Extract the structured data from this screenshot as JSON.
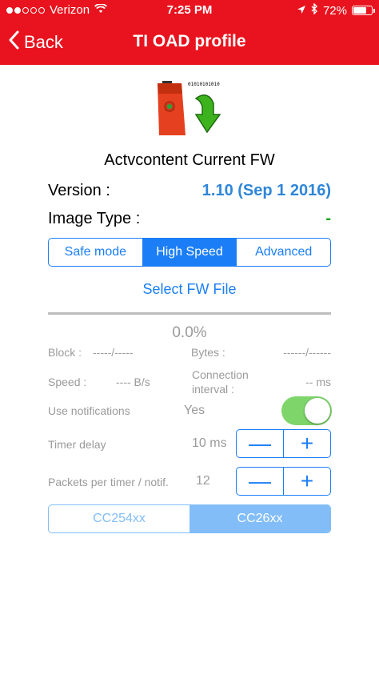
{
  "status": {
    "carrier": "Verizon",
    "time": "7:25 PM",
    "battery": "72%",
    "battery_level": 0.72
  },
  "nav": {
    "back_label": "Back",
    "title": "TI OAD profile"
  },
  "device_image": {
    "binary_text": "01010101010"
  },
  "firmware": {
    "title": "Actvcontent Current FW",
    "version_label": "Version :",
    "version_value": "1.10 (Sep  1 2016)",
    "image_type_label": "Image Type :",
    "image_type_value": "-"
  },
  "mode_tabs": {
    "options": [
      "Safe mode",
      "High Speed",
      "Advanced"
    ],
    "selected": "High Speed"
  },
  "select_fw_label": "Select FW File",
  "progress": {
    "value": 0.0,
    "percent_text": "0.0%"
  },
  "stats": {
    "block_label": "Block :",
    "block_value": "-----/-----",
    "bytes_label": "Bytes :",
    "bytes_value": "------/------",
    "speed_label": "Speed :",
    "speed_value": "---- B/s",
    "conn_label_line1": "Connection",
    "conn_label_line2": "interval :",
    "conn_value": "-- ms"
  },
  "settings": {
    "notifications_label": "Use notifications",
    "notifications_value": "Yes",
    "timer_label": "Timer delay",
    "timer_value": "10 ms",
    "packets_label": "Packets per timer / notif.",
    "packets_value": "12",
    "minus": "—",
    "plus": "+"
  },
  "chip_tabs": {
    "options": [
      "CC254xx",
      "CC26xx"
    ],
    "selected": "CC26xx"
  },
  "colors": {
    "brand_red": "#e8131e",
    "accent_blue": "#1b7ef6",
    "version_blue": "#2f86d8",
    "image_type_green": "#1aa81a",
    "toggle_green": "#7ed66b",
    "chip_blue_light": "#82bdf8"
  }
}
